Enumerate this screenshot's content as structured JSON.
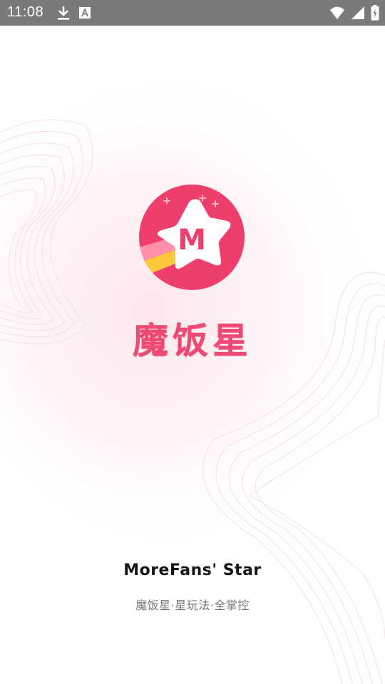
{
  "status_bar": {
    "time": "11:08",
    "icons": [
      "download-icon",
      "font-notification-icon",
      "wifi-icon",
      "signal-icon",
      "battery-charging-icon"
    ]
  },
  "splash": {
    "logo_letter": "M",
    "app_name_cn": "魔饭星",
    "app_name_en": "MoreFans' Star",
    "slogan": "魔饭星·星玩法·全掌控"
  },
  "colors": {
    "brand_pink": "#ec4a72",
    "logo_circle": "#ee3f6c",
    "stripe_yellow": "#ffc83a",
    "stripe_pink": "#ff8fab",
    "status_bar": "#7a7a7a",
    "text_dark": "#151515",
    "text_gray": "#777777"
  }
}
